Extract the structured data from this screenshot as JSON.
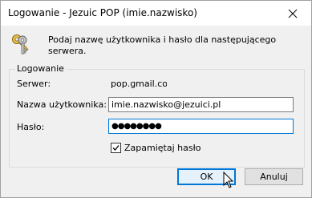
{
  "window": {
    "title": "Logowanie - Jezuic POP (imie.nazwisko)"
  },
  "prompt": {
    "text": "Podaj nazwę użytkownika i hasło dla następującego serwera."
  },
  "group": {
    "legend": "Logowanie",
    "server_label": "Serwer:",
    "server_value": "pop.gmail.com",
    "username_label": "Nazwa użytkownika:",
    "username_value": "imie.nazwisko@jezuici.pl",
    "password_label": "Hasło:",
    "password_value": "●●●●●●●●",
    "remember_label": "Zapamiętaj hasło",
    "remember_checked": true
  },
  "buttons": {
    "ok_label": "OK",
    "cancel_label": "Anuluj"
  },
  "colors": {
    "focus_border": "#0078d7",
    "dialog_bg": "#f0f0f0"
  }
}
